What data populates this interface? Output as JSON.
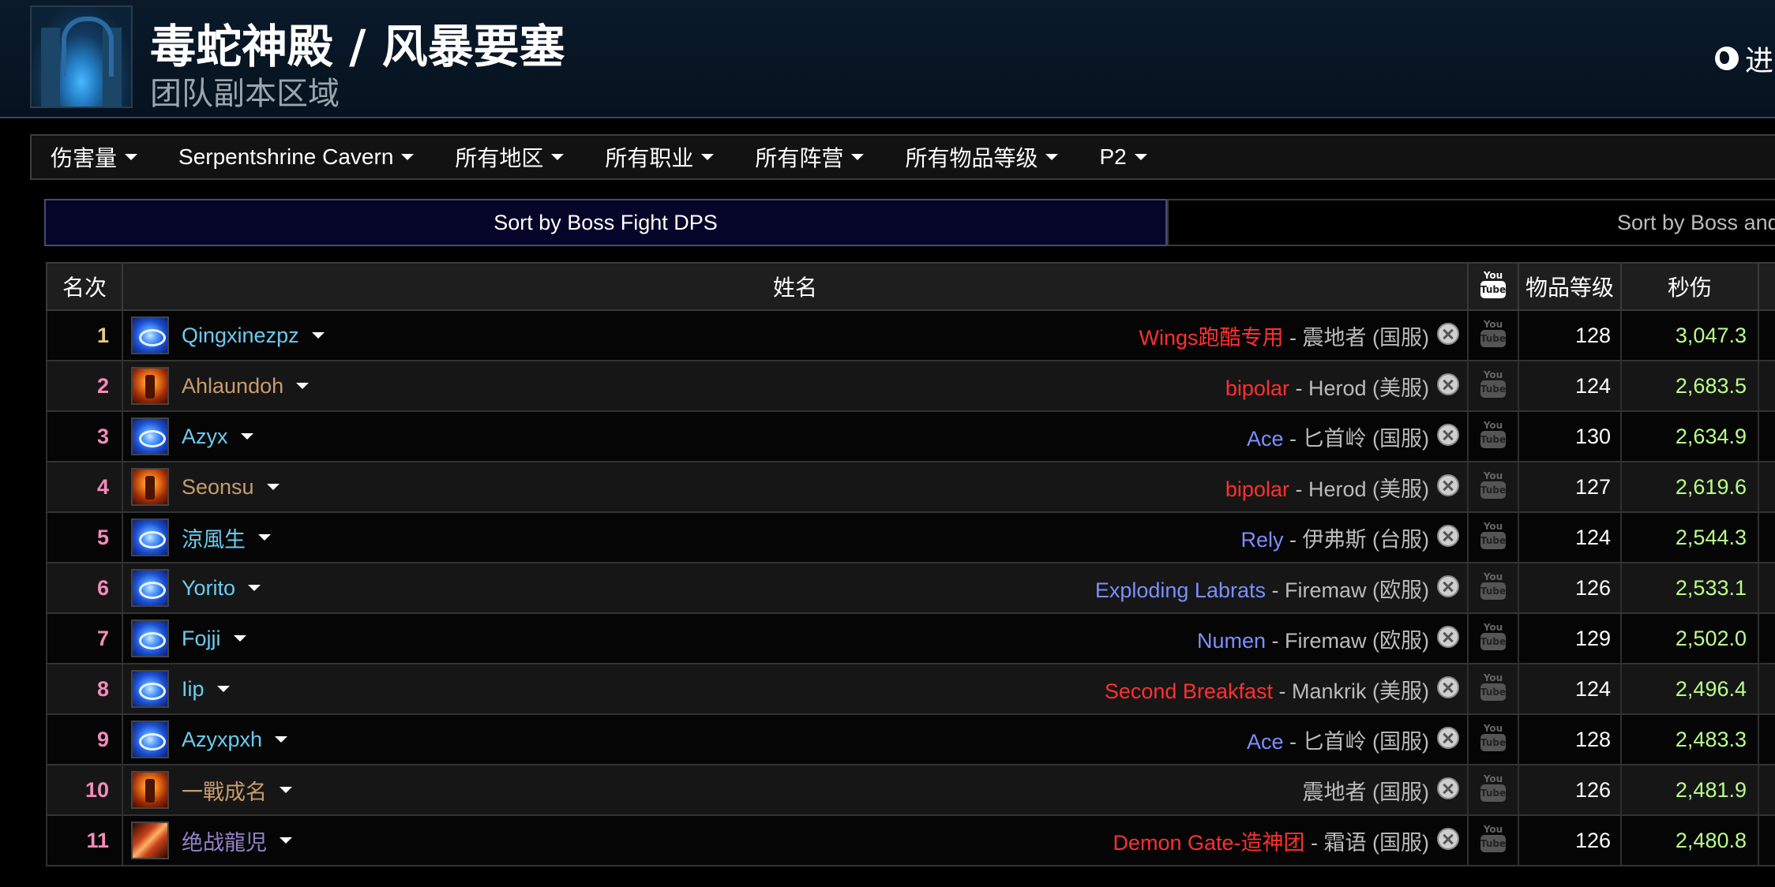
{
  "header": {
    "title": "毒蛇神殿 / 风暴要塞",
    "subtitle": "团队副本区域",
    "lang_label": "进"
  },
  "filters": [
    {
      "label": "伤害量"
    },
    {
      "label": "Serpentshrine Cavern"
    },
    {
      "label": "所有地区"
    },
    {
      "label": "所有职业"
    },
    {
      "label": "所有阵营"
    },
    {
      "label": "所有物品等级"
    },
    {
      "label": "P2"
    }
  ],
  "sort_tabs": {
    "boss_fight": "Sort by Boss Fight DPS",
    "boss_trash": "Sort by Boss and Tras"
  },
  "table": {
    "headers": {
      "rank": "名次",
      "name": "姓名",
      "youtube_top": "You",
      "youtube_bottom": "Tube",
      "ilvl": "物品等级",
      "dps": "秒伤"
    },
    "rows": [
      {
        "rank": "1",
        "name": "Qingxinezpz",
        "class": "mage",
        "icon": "frost",
        "guild": "Wings跑酷专用",
        "guild_color": "red",
        "sep": " - ",
        "realm": "震地者 (国服)",
        "ilvl": "128",
        "dps": "3,047.3"
      },
      {
        "rank": "2",
        "name": "Ahlaundoh",
        "class": "warrior",
        "icon": "warrior",
        "guild": "bipolar",
        "guild_color": "red",
        "sep": " - ",
        "realm": "Herod (美服)",
        "ilvl": "124",
        "dps": "2,683.5"
      },
      {
        "rank": "3",
        "name": "Azyx",
        "class": "mage",
        "icon": "frost",
        "guild": "Ace",
        "guild_color": "blue",
        "sep": " - ",
        "realm": "匕首岭 (国服)",
        "ilvl": "130",
        "dps": "2,634.9"
      },
      {
        "rank": "4",
        "name": "Seonsu",
        "class": "warrior",
        "icon": "warrior",
        "guild": "bipolar",
        "guild_color": "red",
        "sep": " - ",
        "realm": "Herod (美服)",
        "ilvl": "127",
        "dps": "2,619.6"
      },
      {
        "rank": "5",
        "name": "涼風生",
        "class": "mage",
        "icon": "frost",
        "guild": "Rely",
        "guild_color": "blue",
        "sep": " - ",
        "realm": "伊弗斯 (台服)",
        "ilvl": "124",
        "dps": "2,544.3"
      },
      {
        "rank": "6",
        "name": "Yorito",
        "class": "mage",
        "icon": "frost",
        "guild": "Exploding Labrats",
        "guild_color": "blue",
        "sep": " - ",
        "realm": "Firemaw (欧服)",
        "ilvl": "126",
        "dps": "2,533.1"
      },
      {
        "rank": "7",
        "name": "Fojji",
        "class": "mage",
        "icon": "frost",
        "guild": "Numen",
        "guild_color": "blue",
        "sep": " - ",
        "realm": "Firemaw (欧服)",
        "ilvl": "129",
        "dps": "2,502.0"
      },
      {
        "rank": "8",
        "name": "Iip",
        "class": "mage",
        "icon": "frost",
        "guild": "Second Breakfast",
        "guild_color": "red",
        "sep": " - ",
        "realm": "Mankrik (美服)",
        "ilvl": "124",
        "dps": "2,496.4"
      },
      {
        "rank": "9",
        "name": "Azyxpxh",
        "class": "mage",
        "icon": "frost",
        "guild": "Ace",
        "guild_color": "blue",
        "sep": " - ",
        "realm": "匕首岭 (国服)",
        "ilvl": "128",
        "dps": "2,483.3"
      },
      {
        "rank": "10",
        "name": "一戰成名",
        "class": "warrior",
        "icon": "warrior",
        "guild": "",
        "guild_color": "red",
        "sep": "",
        "realm": "震地者 (国服)",
        "ilvl": "126",
        "dps": "2,481.9"
      },
      {
        "rank": "11",
        "name": "绝战龍児",
        "class": "warlock",
        "icon": "warlock",
        "guild": "Demon Gate-造神团",
        "guild_color": "red",
        "sep": " - ",
        "realm": "霜语 (国服)",
        "ilvl": "126",
        "dps": "2,480.8"
      }
    ]
  },
  "colors": {
    "mage": "#69ccf0",
    "warrior": "#c79c6e",
    "warlock": "#9482c9",
    "guild_red": "#ff3030",
    "guild_blue": "#7b8fff",
    "dps": "#b9ff8a",
    "rank": "#f48cba",
    "rank_first": "#e6cc80"
  }
}
